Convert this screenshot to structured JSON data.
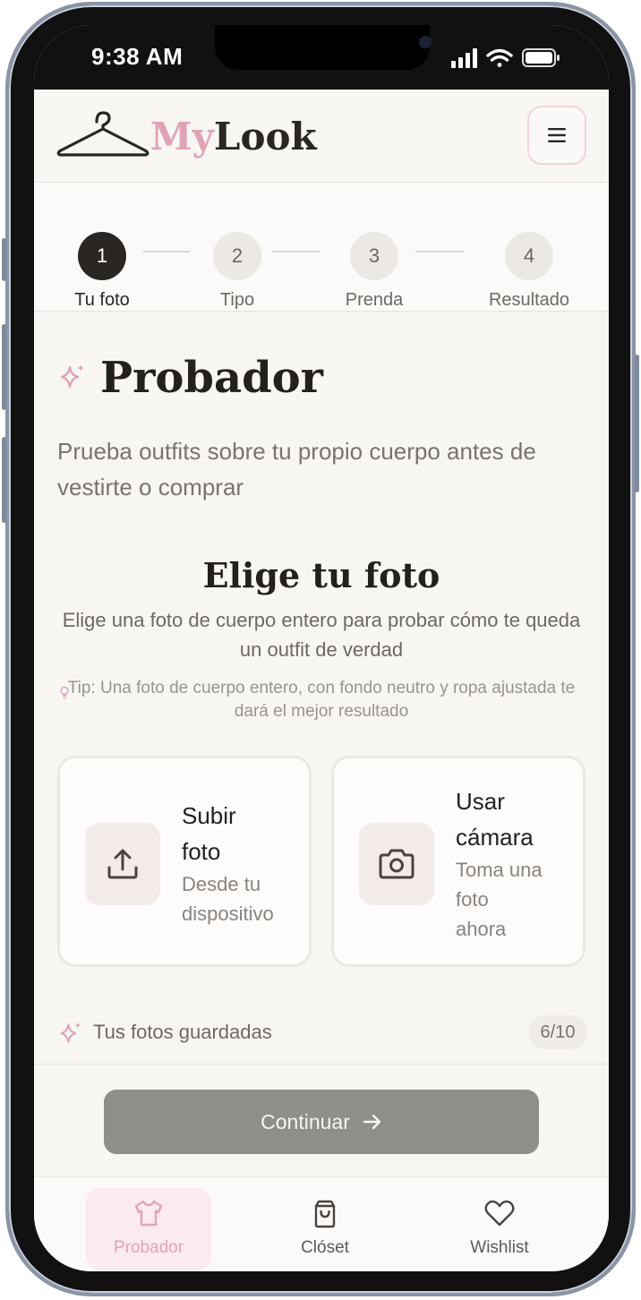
{
  "status_bar": {
    "time": "9:38 AM"
  },
  "header": {
    "brand_my": "My",
    "brand_look": "Look"
  },
  "stepper": {
    "steps": [
      {
        "number": "1",
        "label": "Tu foto"
      },
      {
        "number": "2",
        "label": "Tipo"
      },
      {
        "number": "3",
        "label": "Prenda"
      },
      {
        "number": "4",
        "label": "Resultado"
      }
    ]
  },
  "page": {
    "title": "Probador",
    "subtitle": "Prueba outfits sobre tu propio cuerpo antes de vestirte o comprar"
  },
  "photo_section": {
    "title": "Elige tu foto",
    "description": "Elige una foto de cuerpo entero para probar cómo te queda un outfit de verdad",
    "tip": "Tip: Una foto de cuerpo entero, con fondo neutro y ropa ajustada te dará el mejor resultado"
  },
  "options": {
    "upload": {
      "title_line1": "Subir",
      "title_line2": "foto",
      "sub_line1": "Desde tu",
      "sub_line2": "dispositivo",
      "icon": "upload-icon"
    },
    "camera": {
      "title_line1": "Usar",
      "title_line2": "cámara",
      "sub_line1": "Toma una",
      "sub_line2": "foto",
      "sub_line3": "ahora",
      "icon": "camera-icon"
    }
  },
  "saved_photos": {
    "label": "Tus fotos guardadas",
    "count": "6/10"
  },
  "footer": {
    "continue_label": "Continuar"
  },
  "tabbar": {
    "tabs": [
      {
        "label": "Probador",
        "icon": "tshirt-icon"
      },
      {
        "label": "Clóset",
        "icon": "bag-icon"
      },
      {
        "label": "Wishlist",
        "icon": "heart-icon"
      }
    ]
  },
  "colors": {
    "accent_pink": "#e0a3b6",
    "dark": "#2a2623",
    "disabled_button": "#8f8e8b"
  }
}
